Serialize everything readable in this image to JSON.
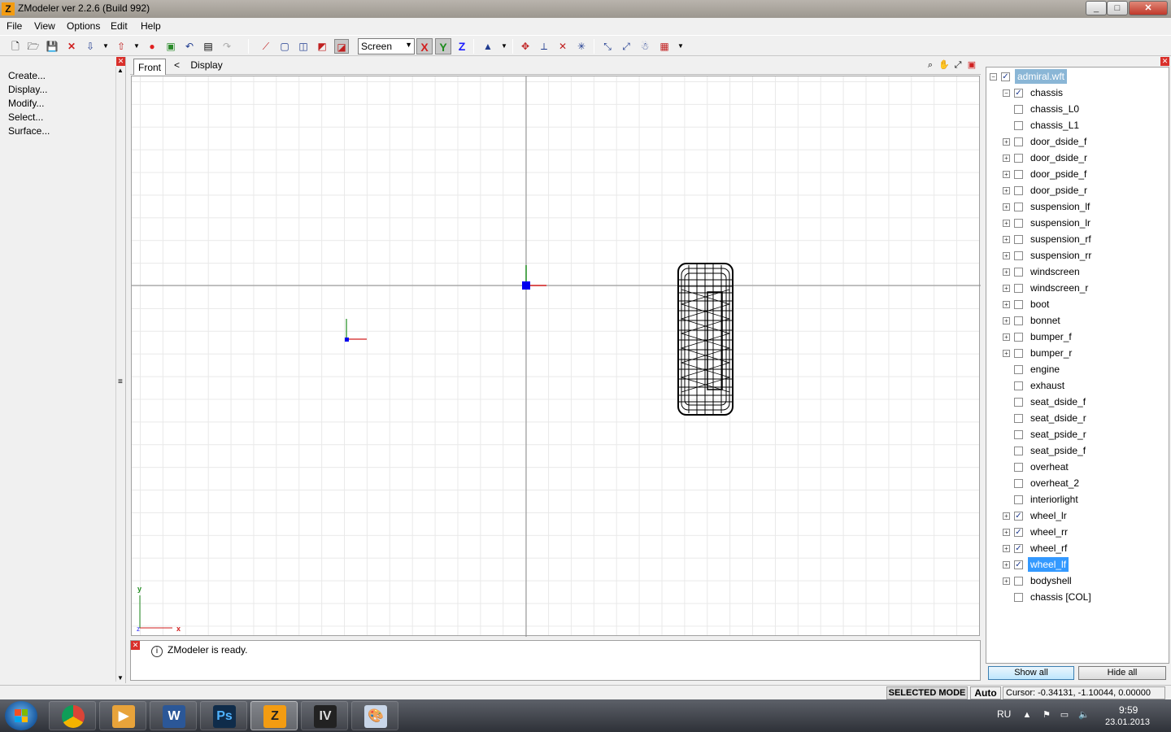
{
  "window": {
    "app_icon": "Z",
    "title": "ZModeler ver 2.2.6 (Build 992)",
    "min": "_",
    "max": "□",
    "close": "✕"
  },
  "menu": [
    "File",
    "View",
    "Options",
    "Edit",
    "Help"
  ],
  "toolbar": {
    "view_mode": "Screen",
    "axis_x": "X",
    "axis_y": "Y",
    "axis_z": "Z",
    "icons": [
      "new-file-icon",
      "open-file-icon",
      "save-icon",
      "delete-icon",
      "import-icon",
      "export-icon",
      "record-icon",
      "render-icon",
      "undo-icon",
      "properties-icon",
      "redo-icon",
      "select-vertex-icon",
      "select-box-icon",
      "select-cube-icon",
      "select-object-icon",
      "select-frame-icon",
      "cone-icon",
      "move-icon",
      "axis-icon",
      "scale-icon",
      "rotate-icon",
      "snap-icon",
      "center-icon",
      "person-icon",
      "material-icon"
    ]
  },
  "left_panel": {
    "items": [
      "Create...",
      "Display...",
      "Modify...",
      "Select...",
      "Surface..."
    ]
  },
  "viewport": {
    "tab": "Front",
    "breadcrumb_arrow": "<",
    "breadcrumb": "Display",
    "axis_label_x": "x",
    "axis_label_y": "y",
    "axis_label_z": "z"
  },
  "log": {
    "message": "ZModeler is ready."
  },
  "tree": {
    "root": {
      "label": "admiral.wft",
      "checked": true
    },
    "chassis": {
      "label": "chassis",
      "checked": true
    },
    "items": [
      {
        "label": "chassis_L0",
        "expandable": false,
        "checked": false
      },
      {
        "label": "chassis_L1",
        "expandable": false,
        "checked": false
      },
      {
        "label": "door_dside_f",
        "expandable": true,
        "checked": false
      },
      {
        "label": "door_dside_r",
        "expandable": true,
        "checked": false
      },
      {
        "label": "door_pside_f",
        "expandable": true,
        "checked": false
      },
      {
        "label": "door_pside_r",
        "expandable": true,
        "checked": false
      },
      {
        "label": "suspension_lf",
        "expandable": true,
        "checked": false
      },
      {
        "label": "suspension_lr",
        "expandable": true,
        "checked": false
      },
      {
        "label": "suspension_rf",
        "expandable": true,
        "checked": false
      },
      {
        "label": "suspension_rr",
        "expandable": true,
        "checked": false
      },
      {
        "label": "windscreen",
        "expandable": true,
        "checked": false
      },
      {
        "label": "windscreen_r",
        "expandable": true,
        "checked": false
      },
      {
        "label": "boot",
        "expandable": true,
        "checked": false
      },
      {
        "label": "bonnet",
        "expandable": true,
        "checked": false
      },
      {
        "label": "bumper_f",
        "expandable": true,
        "checked": false
      },
      {
        "label": "bumper_r",
        "expandable": true,
        "checked": false
      },
      {
        "label": "engine",
        "expandable": false,
        "checked": false
      },
      {
        "label": "exhaust",
        "expandable": false,
        "checked": false
      },
      {
        "label": "seat_dside_f",
        "expandable": false,
        "checked": false
      },
      {
        "label": "seat_dside_r",
        "expandable": false,
        "checked": false
      },
      {
        "label": "seat_pside_r",
        "expandable": false,
        "checked": false
      },
      {
        "label": "seat_pside_f",
        "expandable": false,
        "checked": false
      },
      {
        "label": "overheat",
        "expandable": false,
        "checked": false
      },
      {
        "label": "overheat_2",
        "expandable": false,
        "checked": false
      },
      {
        "label": "interiorlight",
        "expandable": false,
        "checked": false
      },
      {
        "label": "wheel_lr",
        "expandable": true,
        "checked": true
      },
      {
        "label": "wheel_rr",
        "expandable": true,
        "checked": true
      },
      {
        "label": "wheel_rf",
        "expandable": true,
        "checked": true
      },
      {
        "label": "wheel_lf",
        "expandable": true,
        "checked": true,
        "selected": true
      },
      {
        "label": "bodyshell",
        "expandable": true,
        "checked": false
      },
      {
        "label": "chassis [COL]",
        "expandable": false,
        "checked": false
      }
    ],
    "show_all": "Show all",
    "hide_all": "Hide all"
  },
  "status": {
    "mode": "SELECTED MODE",
    "auto": "Auto",
    "cursor": "Cursor: -0.34131, -1.10044, 0.00000"
  },
  "taskbar": {
    "apps": [
      {
        "name": "chrome",
        "label": ""
      },
      {
        "name": "media-player",
        "label": ""
      },
      {
        "name": "word",
        "label": "W"
      },
      {
        "name": "photoshop",
        "label": "Ps"
      },
      {
        "name": "zmodeler",
        "label": "Z",
        "active": true
      },
      {
        "name": "gta-iv",
        "label": "IV"
      },
      {
        "name": "paint",
        "label": ""
      }
    ],
    "lang": "RU",
    "time": "9:59",
    "date": "23.01.2013"
  },
  "colors": {
    "selection": "#3399ff",
    "axis_x": "#d21e1e",
    "axis_y": "#1e8c1e",
    "axis_z": "#1e1eff"
  }
}
